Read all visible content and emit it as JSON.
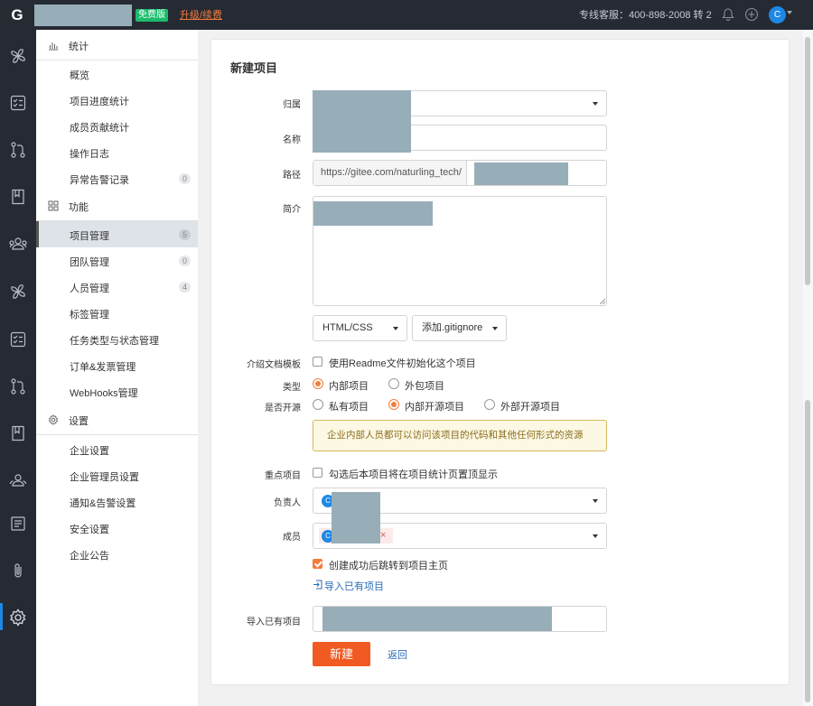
{
  "topbar": {
    "logo": "G",
    "free_badge": "免费版",
    "upgrade_link": "升级/续费",
    "hotline": "专线客服：400-898-2008 转 2",
    "avatar_initial": "C",
    "icons": [
      "bell-icon",
      "plus-circle-icon"
    ]
  },
  "leftbar": {
    "icons": [
      "fan-icon",
      "task-list-icon",
      "pull-request-icon",
      "book-icon",
      "team-icon",
      "fan-icon",
      "task-list-icon",
      "pull-request-icon",
      "book-icon",
      "team-icon",
      "document-icon",
      "paperclip-icon",
      "gear-icon"
    ],
    "active": "gear-icon"
  },
  "sidebar": {
    "sections": [
      {
        "title": "统计",
        "icon": "bar-chart-icon",
        "items": [
          {
            "label": "概览",
            "badge": ""
          },
          {
            "label": "项目进度统计",
            "badge": ""
          },
          {
            "label": "成员贡献统计",
            "badge": ""
          },
          {
            "label": "操作日志",
            "badge": ""
          },
          {
            "label": "异常告警记录",
            "badge": "0"
          }
        ]
      },
      {
        "title": "功能",
        "icon": "grid-icon",
        "items": [
          {
            "label": "项目管理",
            "badge": "5",
            "active": true
          },
          {
            "label": "团队管理",
            "badge": "0"
          },
          {
            "label": "人员管理",
            "badge": "4"
          },
          {
            "label": "标签管理",
            "badge": ""
          },
          {
            "label": "任务类型与状态管理",
            "badge": ""
          },
          {
            "label": "订单&发票管理",
            "badge": ""
          },
          {
            "label": "WebHooks管理",
            "badge": ""
          }
        ]
      },
      {
        "title": "设置",
        "icon": "gear-icon",
        "items": [
          {
            "label": "企业设置",
            "badge": ""
          },
          {
            "label": "企业管理员设置",
            "badge": ""
          },
          {
            "label": "通知&告警设置",
            "badge": ""
          },
          {
            "label": "安全设置",
            "badge": ""
          },
          {
            "label": "企业公告",
            "badge": ""
          }
        ]
      }
    ]
  },
  "form": {
    "title": "新建项目",
    "labels": {
      "owner": "归属",
      "name": "名称",
      "path": "路径",
      "intro": "简介",
      "template": "介绍文档模板",
      "type": "类型",
      "open_source": "是否开源",
      "key_project": "重点项目",
      "leader": "负责人",
      "members": "成员",
      "import_existing": "导入已有项目"
    },
    "path_prefix": "https://gitee.com/naturling_tech/",
    "language_select": "HTML/CSS",
    "gitignore_select": "添加.gitignore",
    "readme_option": "使用Readme文件初始化这个项目",
    "readme_checked": false,
    "type_options": [
      {
        "label": "内部项目",
        "selected": true
      },
      {
        "label": "外包项目",
        "selected": false
      }
    ],
    "open_source_options": [
      {
        "label": "私有项目",
        "selected": false
      },
      {
        "label": "内部开源项目",
        "selected": true
      },
      {
        "label": "外部开源项目",
        "selected": false
      }
    ],
    "notice": "企业内部人员都可以访问该项目的代码和其他任何形式的资源",
    "key_project_option": "勾选后本项目将在项目统计页置顶显示",
    "key_project_checked": false,
    "leader_chip": "C",
    "member_chip": "C",
    "member_remove": "×",
    "redirect_option": "创建成功后跳转到项目主页",
    "redirect_checked": true,
    "import_link": "导入已有项目",
    "submit": "新建",
    "back": "返回"
  },
  "colors": {
    "accent": "#f15a22",
    "link": "#2a6bb8",
    "topbar": "#262a33",
    "free_badge": "#1abc6c"
  }
}
